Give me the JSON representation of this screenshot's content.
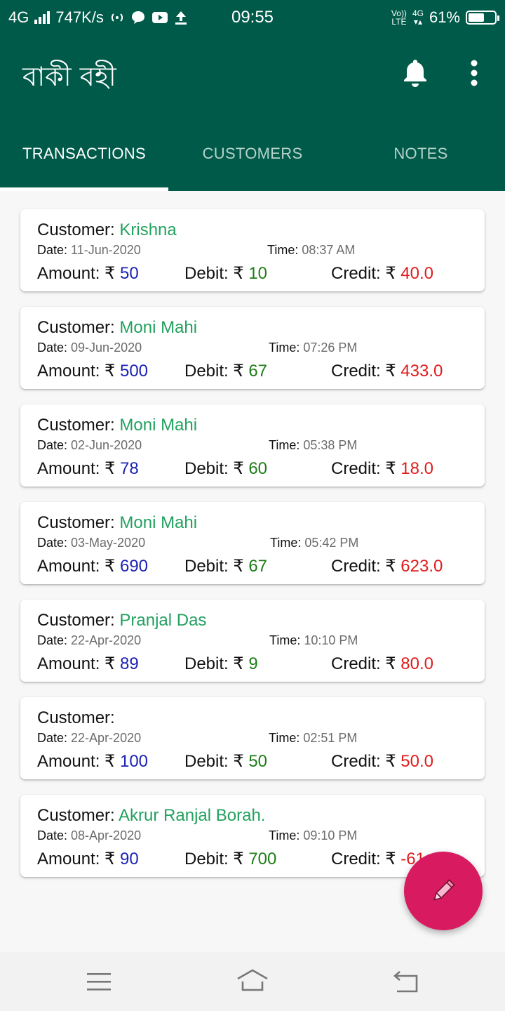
{
  "status_bar": {
    "network": "4G",
    "speed": "747K/s",
    "time": "09:55",
    "volte_top": "Vo))",
    "volte_bottom": "LTE",
    "net2_top": "4G",
    "battery": "61%",
    "battery_level": 0.61
  },
  "app_bar": {
    "title": "বাকী বহী",
    "icons": [
      "bell-icon",
      "more-vertical-icon"
    ]
  },
  "tabs": [
    {
      "label": "TRANSACTIONS",
      "active": true
    },
    {
      "label": "CUSTOMERS",
      "active": false
    },
    {
      "label": "NOTES",
      "active": false
    }
  ],
  "labels": {
    "customer": "Customer: ",
    "date": "Date: ",
    "time": "Time: ",
    "amount": "Amount: ₹ ",
    "debit": "Debit: ₹ ",
    "credit": "Credit: ₹ "
  },
  "transactions": [
    {
      "customer": "Krishna",
      "date": "11-Jun-2020",
      "time": "08:37 AM",
      "amount": "50",
      "debit": "10",
      "credit": "40.0"
    },
    {
      "customer": "Moni Mahi",
      "date": "09-Jun-2020",
      "time": "07:26 PM",
      "amount": "500",
      "debit": "67",
      "credit": "433.0"
    },
    {
      "customer": "Moni Mahi",
      "date": "02-Jun-2020",
      "time": "05:38 PM",
      "amount": "78",
      "debit": "60",
      "credit": "18.0"
    },
    {
      "customer": "Moni Mahi",
      "date": "03-May-2020",
      "time": "05:42 PM",
      "amount": "690",
      "debit": "67",
      "credit": "623.0"
    },
    {
      "customer": "Pranjal Das",
      "date": "22-Apr-2020",
      "time": "10:10 PM",
      "amount": "89",
      "debit": "9",
      "credit": "80.0"
    },
    {
      "customer": "",
      "date": "22-Apr-2020",
      "time": "02:51 PM",
      "amount": "100",
      "debit": "50",
      "credit": "50.0"
    },
    {
      "customer": "Akrur Ranjal Borah.",
      "date": "08-Apr-2020",
      "time": "09:10 PM",
      "amount": "90",
      "debit": "700",
      "credit": "-61"
    }
  ],
  "fab": {
    "icon": "pencil-icon"
  },
  "colors": {
    "primary": "#005a49",
    "accent": "#d81b60",
    "customer_name": "#23a15f",
    "amount": "#1c22b5",
    "debit": "#1e7d16",
    "credit": "#e01b1b"
  }
}
